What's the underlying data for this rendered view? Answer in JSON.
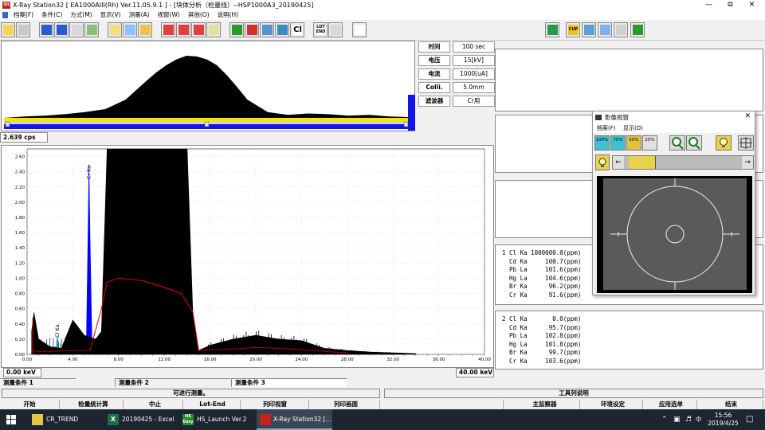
{
  "window": {
    "title": "X-Ray Station32 [ EA1000AIII(Rh) Ver.11.05.9.1 ] - [块体分析（检量线）--HSP1000A3_20190425]",
    "app_icon_text": "SII"
  },
  "menu": [
    "档案(F)",
    "条件(C)",
    "方式(M)",
    "显示(V)",
    "测量(A)",
    "视窗(W)",
    "其他(O)",
    "说明(H)"
  ],
  "toolbar": {
    "buttons": [
      "open-folder-icon",
      "save-icon",
      "calibrate-icon",
      "element-icon",
      "memory-icon",
      "hourglass-icon",
      "percent-s-icon",
      "percent-q-icon",
      "compare-icon",
      "cancel-icon",
      "cancel-x-icon",
      "cancel-spec-icon",
      "peaks-icon",
      "person-green-icon",
      "person-red-icon",
      "camera-icon",
      "target-icon",
      "cl-icon",
      "lot-end-icon",
      "printer-icon",
      "report-icon",
      "export-icon",
      "cup-icon",
      "photo-icon",
      "monitor-icon",
      "print2-icon",
      "exit-icon"
    ],
    "cl_label": "Cl",
    "lot_end_label": "LOT END",
    "cup_label": "CUP"
  },
  "count_rate": "2.639 cps",
  "params": [
    {
      "label": "时间",
      "value": "100 sec"
    },
    {
      "label": "电压",
      "value": "15[kV]"
    },
    {
      "label": "电流",
      "value": "1000[uA]"
    },
    {
      "label": "Colli.",
      "value": "5.0mm"
    },
    {
      "label": "滤波器",
      "value": "Cr用"
    }
  ],
  "spectrum": {
    "y_ticks": [
      "2.60",
      "2.40",
      "2.20",
      "2.00",
      "1.80",
      "1.60",
      "1.40",
      "1.20",
      "1.00",
      "0.80",
      "0.60",
      "0.40",
      "0.20",
      "0.00"
    ],
    "x_ticks": [
      "0.00",
      "4.00",
      "8.00",
      "12.00",
      "16.00",
      "20.00",
      "24.00",
      "28.00",
      "32.00",
      "36.00",
      "40.00"
    ],
    "peak_labels": [
      "Cl Ka",
      "Cr Ka"
    ],
    "start_kev": "0.00 keV",
    "end_kev": "40.00 keV"
  },
  "chart_data": {
    "type": "area",
    "x_unit": "keV",
    "xlim": [
      0,
      40
    ],
    "ylim": [
      0,
      2.7
    ],
    "grid": true,
    "series": [
      {
        "name": "Cl Ka",
        "color": "#00e5e5",
        "x": [
          2.55,
          2.62,
          2.7,
          2.78
        ],
        "y": [
          0.05,
          0.2,
          0.25,
          0.05
        ]
      },
      {
        "name": "Cr Ka",
        "color": "#0000ff",
        "x": [
          5.2,
          5.35,
          5.41,
          5.5,
          5.65
        ],
        "y": [
          0.3,
          1.8,
          2.5,
          1.6,
          0.3
        ]
      },
      {
        "name": "spectrum",
        "color": "#000000",
        "x": [
          0.4,
          0.6,
          1,
          2,
          3,
          4,
          5,
          6,
          6.5,
          7,
          7.1,
          8,
          10,
          12,
          13,
          14,
          14.5,
          15,
          16,
          18,
          20,
          22,
          24,
          26,
          28,
          30,
          32,
          34
        ],
        "y": [
          0.3,
          0.55,
          0.2,
          0.1,
          0.08,
          0.45,
          0.25,
          0.2,
          0.3,
          2.7,
          2.7,
          2.7,
          2.7,
          2.7,
          2.7,
          2.7,
          0.5,
          0.05,
          0.12,
          0.2,
          0.25,
          0.2,
          0.18,
          0.08,
          0.05,
          0.03,
          0.02,
          0.01
        ]
      },
      {
        "name": "background",
        "color": "#e00000",
        "x": [
          0.5,
          1,
          2,
          4,
          5.5,
          6.5,
          7,
          8,
          10,
          12,
          13.5,
          14.5,
          15,
          16,
          18,
          20,
          22,
          24,
          26,
          28
        ],
        "y": [
          0.05,
          0.04,
          0.04,
          0.05,
          0.05,
          0.6,
          0.95,
          1.0,
          0.97,
          0.88,
          0.8,
          0.55,
          0.05,
          0.06,
          0.07,
          0.09,
          0.08,
          0.06,
          0.04,
          0.02
        ]
      }
    ]
  },
  "top_plot": {
    "x": [
      0,
      1,
      2,
      3,
      4,
      5,
      6,
      7,
      7.5,
      8,
      8.5,
      9,
      9.5,
      10,
      10.5,
      11,
      11.5,
      12,
      13,
      14,
      15,
      16,
      17,
      18,
      19,
      20
    ],
    "y": [
      0,
      0.02,
      0.03,
      0.05,
      0.08,
      0.12,
      0.25,
      0.5,
      0.62,
      0.72,
      0.8,
      0.85,
      0.84,
      0.8,
      0.72,
      0.58,
      0.42,
      0.25,
      0.08,
      0.04,
      0.06,
      0.05,
      0.03,
      0.04,
      0.02,
      0.01
    ]
  },
  "results": [
    {
      "rows": [
        "1 Cl Ka 1000000.0(ppm)",
        "  Cd Ka     100.7(ppm)",
        "  Pb La     101.6(ppm)",
        "  Hg La     104.6(ppm)",
        "  Br Ka      96.2(ppm)",
        "  Cr Ka      91.6(ppm)"
      ]
    },
    {
      "rows": [
        "2 Cl Ka       0.0(ppm)",
        "  Cd Ka      95.7(ppm)",
        "  Pb La     102.8(ppm)",
        "  Hg La     101.8(ppm)",
        "  Br Ka      99.7(ppm)",
        "  Cr Ka     103.6(ppm)"
      ]
    }
  ],
  "image_dialog": {
    "title": "影像视窗",
    "menu": [
      "档案(F)",
      "显示(D)"
    ],
    "zoom": [
      "100%",
      "75%",
      "50%",
      "25%"
    ]
  },
  "tabs": [
    "测量条件 1",
    "测量条件 2",
    "测量条件 3"
  ],
  "status": {
    "message": "可进行测量。",
    "tool_desc": "工具列说明"
  },
  "function_keys": [
    "开始",
    "检量统计算",
    "中止",
    "Lot-End",
    "列印视窗",
    "列印画面",
    "",
    "主监察器",
    "环境设定",
    "应用选单",
    "结束"
  ],
  "taskbar": {
    "items": [
      "CR_TREND",
      "20190425 - Excel",
      "HS_Launch Ver.2",
      "X-Ray Station32 [..."
    ],
    "hs_icon_text": "HS Easy",
    "time": "15:56",
    "date": "2019/4/25",
    "ime": "中"
  },
  "colors": {
    "cl": "#00e5e5",
    "cr": "#0000ff",
    "bg_line": "#e00000",
    "top_baseline": "#1414e6",
    "top_bar": "#f0e800"
  }
}
